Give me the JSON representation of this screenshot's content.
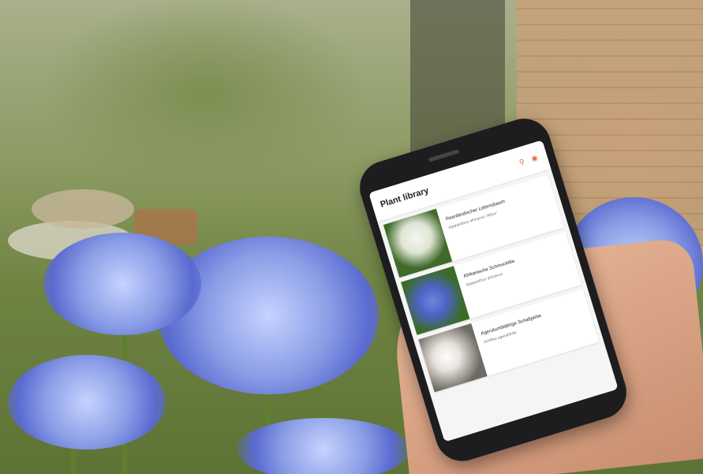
{
  "app": {
    "title": "Plant library",
    "icons": [
      "search-icon",
      "camera-icon"
    ],
    "accent_color": "#e8632e"
  },
  "plants": [
    {
      "name": "Reenländischer Lebensbaum",
      "latin": "Agapanthus africanus 'Albus'"
    },
    {
      "name": "Afrikanische Schmucklilie",
      "latin": "Agapanthus africanus"
    },
    {
      "name": "Agerutumblättrige Schafgarbe",
      "latin": "Achillea ageratifolia"
    }
  ]
}
